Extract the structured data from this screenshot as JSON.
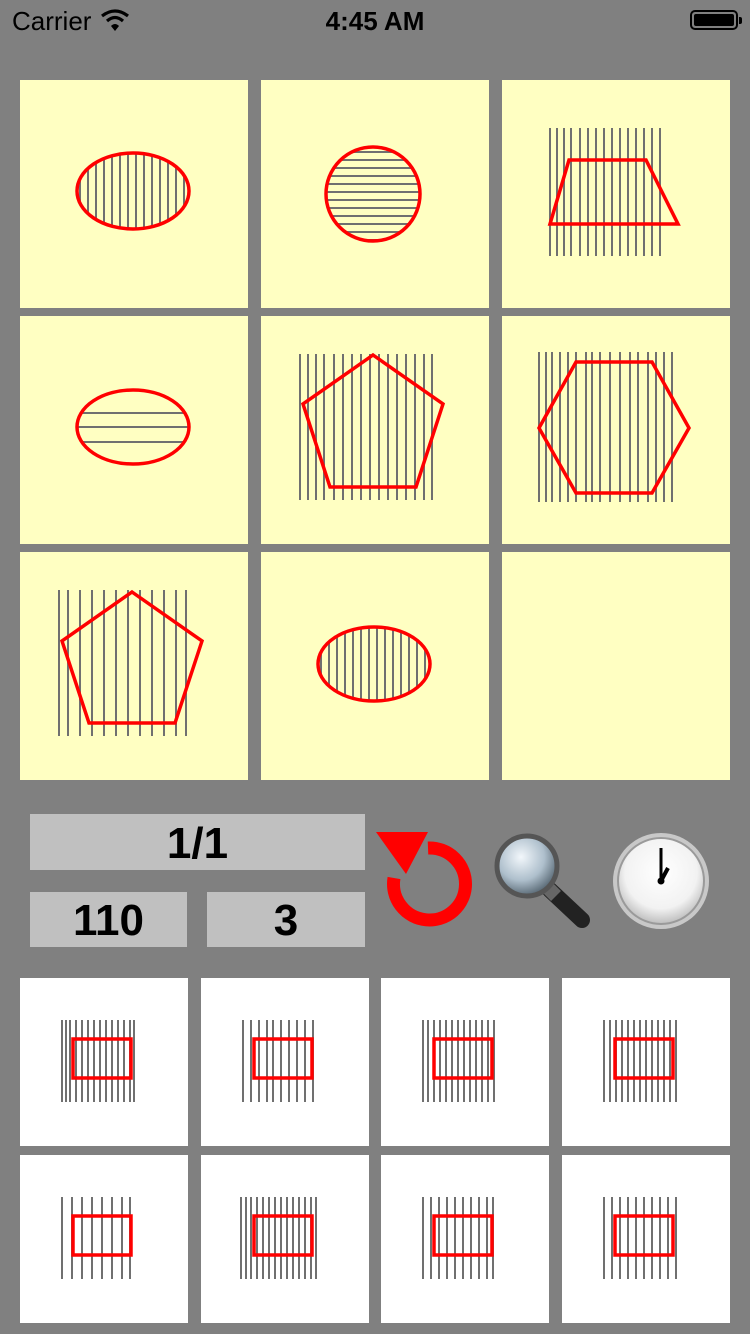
{
  "status_bar": {
    "carrier": "Carrier",
    "time": "4:45 AM"
  },
  "board": {
    "tiles": [
      {
        "shape": "ellipse",
        "hatch": "vertical"
      },
      {
        "shape": "circle",
        "hatch": "horizontal"
      },
      {
        "shape": "trapezoid",
        "hatch": "vertical"
      },
      {
        "shape": "ellipse",
        "hatch": "horizontal"
      },
      {
        "shape": "pentagon",
        "hatch": "vertical"
      },
      {
        "shape": "hexagon",
        "hatch": "vertical"
      },
      {
        "shape": "pentagon",
        "hatch": "vertical"
      },
      {
        "shape": "ellipse",
        "hatch": "vertical"
      },
      {
        "shape": "empty",
        "hatch": "none"
      }
    ]
  },
  "stats": {
    "progress": "1/1",
    "score": "110",
    "count": "3"
  },
  "controls": {
    "restart_icon": "circular-arrow-icon",
    "hint_icon": "magnifier-icon",
    "timer_icon": "clock-icon"
  },
  "pieces": [
    {
      "shape": "rectangle",
      "hatch": "vertical"
    },
    {
      "shape": "rectangle",
      "hatch": "vertical"
    },
    {
      "shape": "rectangle",
      "hatch": "vertical"
    },
    {
      "shape": "rectangle",
      "hatch": "vertical"
    },
    {
      "shape": "rectangle",
      "hatch": "vertical"
    },
    {
      "shape": "rectangle",
      "hatch": "vertical"
    },
    {
      "shape": "rectangle",
      "hatch": "vertical"
    },
    {
      "shape": "rectangle",
      "hatch": "vertical"
    }
  ],
  "colors": {
    "background": "#808080",
    "tile": "#ffffc2",
    "shape_stroke": "#ff0000",
    "hatch": "#707070",
    "stat_box": "#c0c0c0"
  }
}
